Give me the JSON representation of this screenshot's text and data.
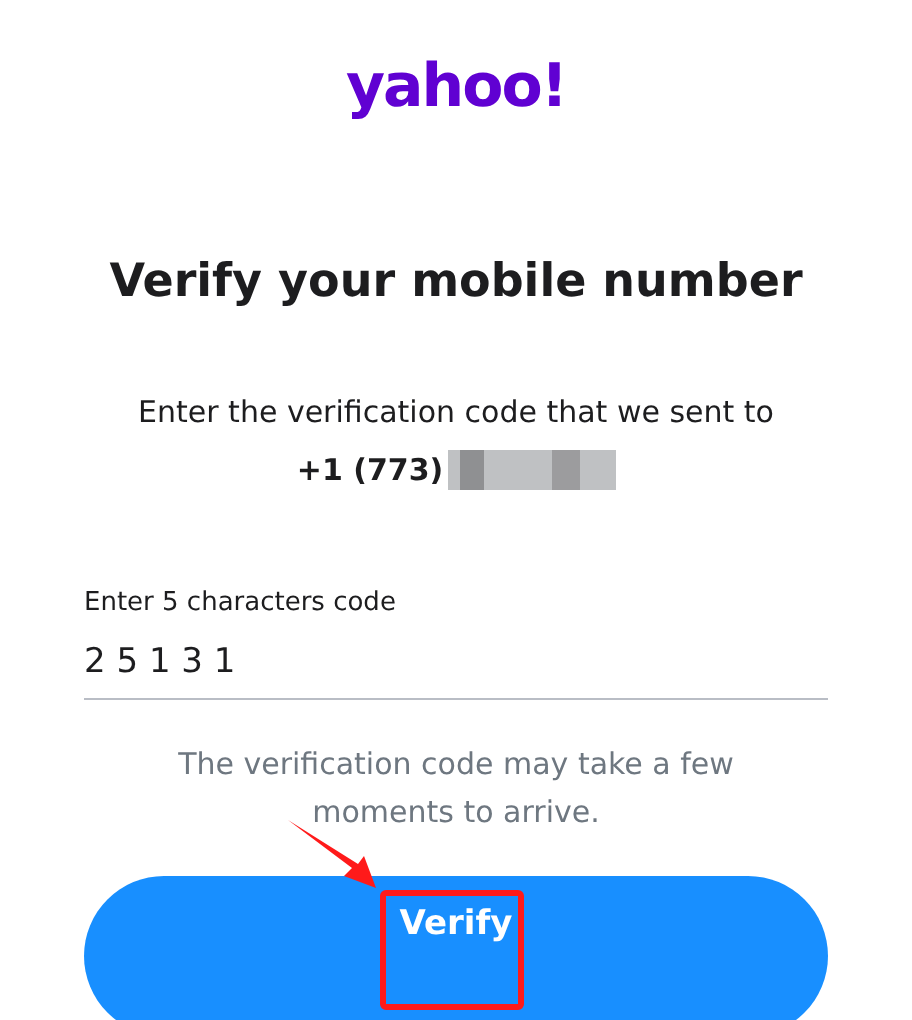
{
  "logo": "yahoo!",
  "title": "Verify your mobile number",
  "instruction": "Enter the verification code that we sent to",
  "phone": {
    "prefix": "+1 (773)",
    "redacted": true
  },
  "code_field": {
    "label": "Enter 5 characters code",
    "value": "2 5 1 3 1"
  },
  "hint": "The verification code may take a few moments to arrive.",
  "verify_button": {
    "label": "Verify",
    "annotated": true
  }
}
